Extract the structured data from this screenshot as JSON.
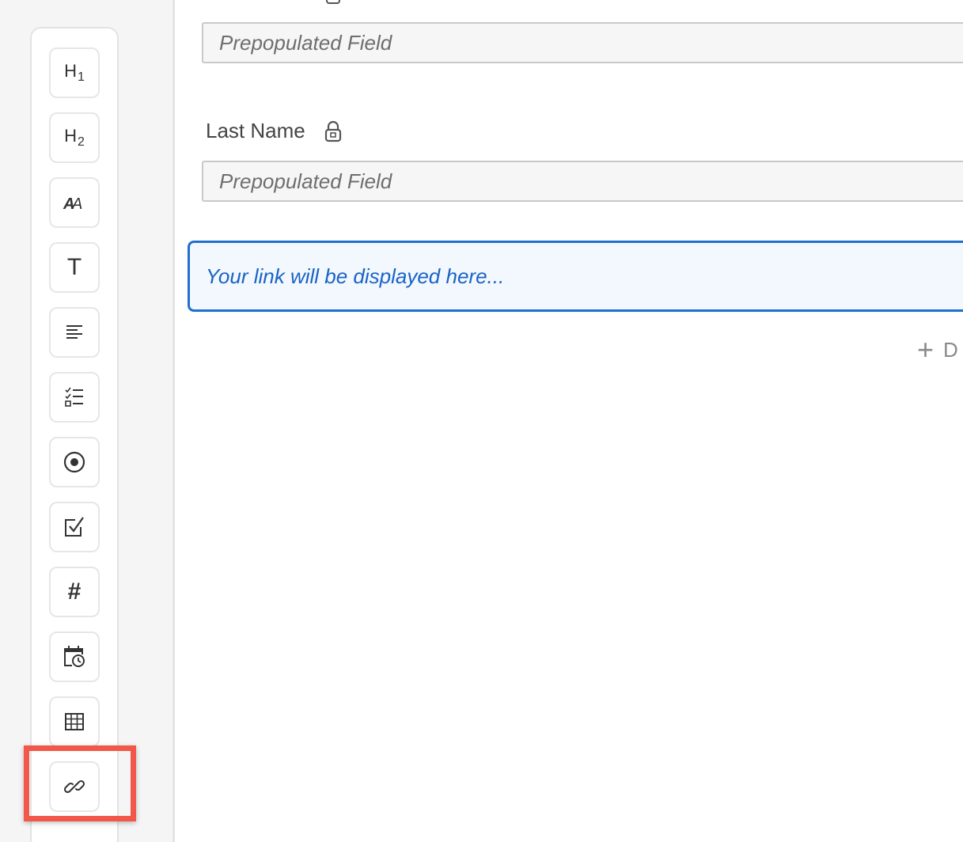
{
  "toolbar": {
    "items": [
      {
        "name": "heading-1",
        "label": "H",
        "sub": "1"
      },
      {
        "name": "heading-2",
        "label": "H",
        "sub": "2"
      },
      {
        "name": "text-style"
      },
      {
        "name": "text",
        "label": "T"
      },
      {
        "name": "paragraph"
      },
      {
        "name": "checklist"
      },
      {
        "name": "radio"
      },
      {
        "name": "checkbox"
      },
      {
        "name": "number",
        "label": "#"
      },
      {
        "name": "date"
      },
      {
        "name": "table"
      },
      {
        "name": "link"
      }
    ],
    "highlighted": "link"
  },
  "form": {
    "first_field_placeholder": "Prepopulated Field",
    "last_name_label": "Last Name",
    "last_name_placeholder": "Prepopulated Field",
    "link_placeholder": "Your link will be displayed here...",
    "add_label": "D"
  },
  "colors": {
    "highlight": "#f1574a",
    "link_accent": "#1f6fd0"
  }
}
